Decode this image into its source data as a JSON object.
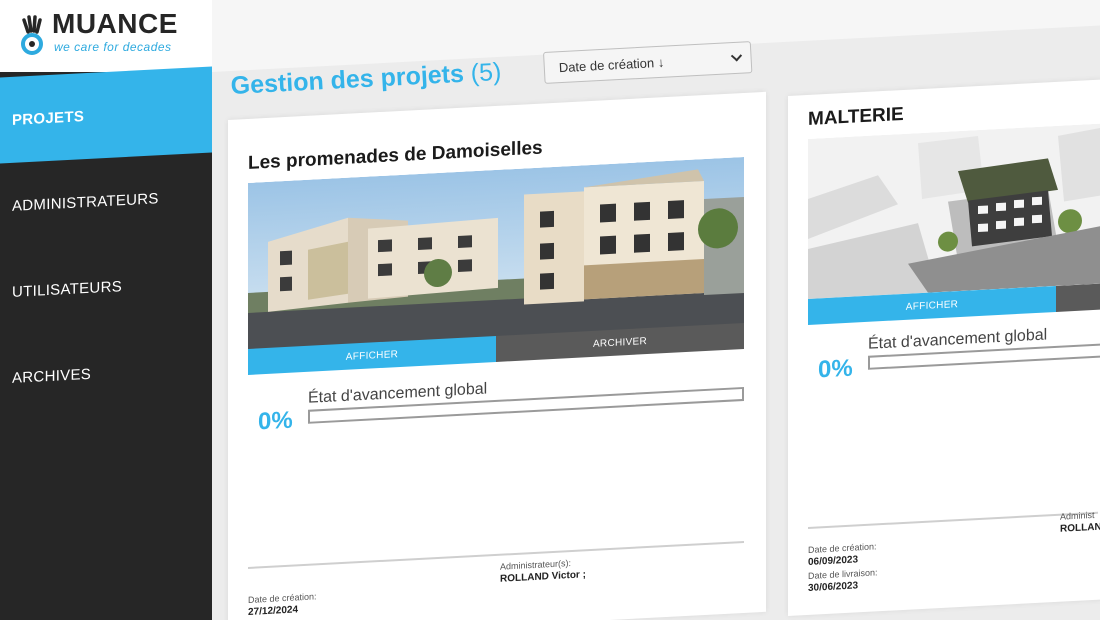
{
  "brand": {
    "name": "MUANCE",
    "tagline": "we care for decades",
    "accent_color": "#34b4ea",
    "sidebar_color": "#262626"
  },
  "sidebar": {
    "items": [
      {
        "label": "PROJETS",
        "active": true
      },
      {
        "label": "ADMINISTRATEURS",
        "active": false
      },
      {
        "label": "UTILISATEURS",
        "active": false
      },
      {
        "label": "ARCHIVES",
        "active": false
      }
    ]
  },
  "header": {
    "title": "Gestion des projets",
    "count": "(5)",
    "sort": {
      "selected": "Date de création ↓",
      "icon": "chevron-down-icon"
    }
  },
  "projects": [
    {
      "name": "Les promenades de Damoiselles",
      "buttons": {
        "view": "AFFICHER",
        "archive": "ARCHIVER"
      },
      "progress": {
        "value": "0%",
        "fraction": 0,
        "label": "État d'avancement global"
      },
      "creation_label": "Date de création:",
      "creation_date": "27/12/2024",
      "admin_label": "Administrateur(s):",
      "admin_value": "ROLLAND Victor ;"
    },
    {
      "name": "MALTERIE",
      "buttons": {
        "view": "AFFICHER",
        "archive": ""
      },
      "progress": {
        "value": "0%",
        "fraction": 0,
        "label": "État d'avancement global"
      },
      "creation_label": "Date de création:",
      "creation_date": "06/09/2023",
      "delivery_label": "Date de livraison:",
      "delivery_date": "30/06/2023",
      "admin_label": "Administ",
      "admin_value": "ROLLAND"
    }
  ]
}
